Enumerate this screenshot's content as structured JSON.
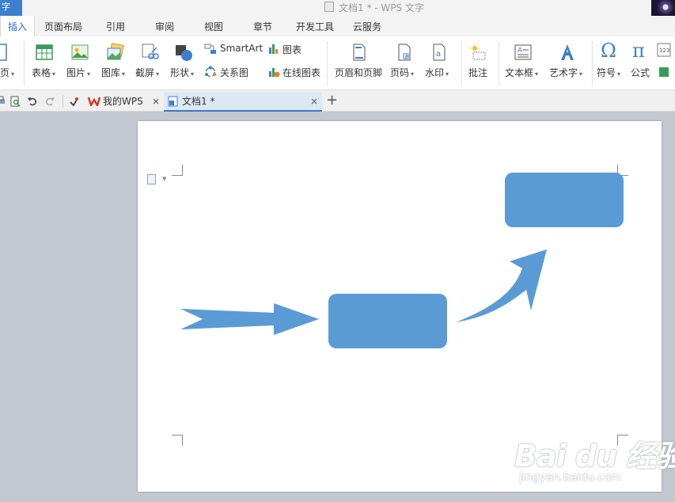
{
  "window": {
    "app_tab_label": "字",
    "title": "文档1 * - WPS 文字"
  },
  "menu": {
    "tabs": [
      {
        "label": "插入",
        "active": true
      },
      {
        "label": "页面布局"
      },
      {
        "label": "引用"
      },
      {
        "label": "审阅"
      },
      {
        "label": "视图"
      },
      {
        "label": "章节"
      },
      {
        "label": "开发工具"
      },
      {
        "label": "云服务"
      }
    ]
  },
  "ribbon": {
    "page_label": "页",
    "table_label": "表格",
    "picture_label": "图片",
    "gallery_label": "图库",
    "screenshot_label": "截屏",
    "shape_label": "形状",
    "smartart_label": "SmartArt",
    "chart_label": "图表",
    "relation_label": "关系图",
    "online_chart_label": "在线图表",
    "header_footer_label": "页眉和页脚",
    "page_number_label": "页码",
    "watermark_label": "水印",
    "comment_label": "批注",
    "textbox_label": "文本框",
    "wordart_label": "艺术字",
    "symbol_label": "符号",
    "formula_label": "公式"
  },
  "tabs": {
    "wps_tab_label": "我的WPS",
    "doc_tab_label": "文档1 *",
    "close_glyph": "×",
    "new_tab_glyph": "+"
  },
  "colors": {
    "shape_fill": "#5b9bd5",
    "accent": "#3d7fcf"
  },
  "watermark": {
    "logo_text": "Bai du 经验",
    "url_text": "jingyan.baidu.com"
  }
}
